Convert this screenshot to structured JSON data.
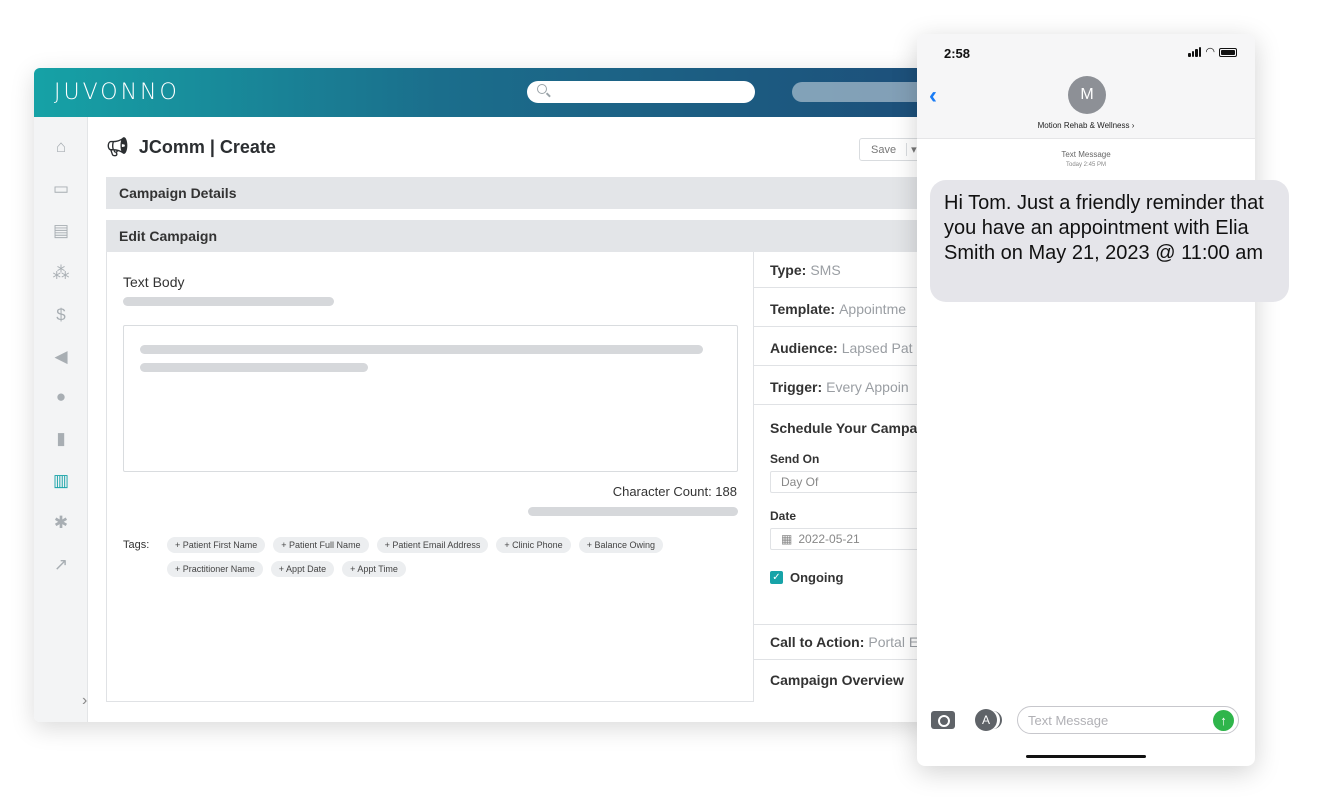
{
  "app": {
    "logo": "JUVONNO",
    "page_title": "JComm | Create",
    "save_label": "Save",
    "save_caret": "▾",
    "sections": {
      "campaign_details": "Campaign Details",
      "edit_campaign": "Edit Campaign"
    },
    "editor": {
      "text_body_label": "Text Body",
      "character_count": "Character Count: 188",
      "tags_label": "Tags:",
      "tags": [
        "+ Patient First Name",
        "+ Patient Full Name",
        "+ Patient Email Address",
        "+ Clinic Phone",
        "+ Balance Owing",
        "+ Practitioner Name",
        "+ Appt Date",
        "+ Appt Time"
      ]
    },
    "settings": {
      "type_label": "Type:",
      "type_value": "SMS",
      "template_label": "Template:",
      "template_value": "Appointme",
      "audience_label": "Audience:",
      "audience_value": "Lapsed Pat",
      "trigger_label": "Trigger:",
      "trigger_value": "Every Appoin",
      "schedule_title": "Schedule Your Campa",
      "send_on_label": "Send On",
      "send_on_value": "Day Of",
      "date_label": "Date",
      "date_value": "2022-05-21",
      "ongoing_label": "Ongoing",
      "ongoing_checked": true,
      "cta_label": "Call to Action:",
      "cta_value": "Portal E",
      "overview_label": "Campaign Overview"
    },
    "accent_color": "#17a3a8"
  },
  "phone": {
    "time": "2:58",
    "avatar_initial": "M",
    "contact_name": "Motion Rehab & Wellness  ›",
    "message_type": "Text Message",
    "message_time": "Today 2:45 PM",
    "message_body": "Hi Tom. Just a friendly reminder that you have an appointment with Elia Smith on May 21, 2023 @ 11:00 am",
    "input_placeholder": "Text Message"
  }
}
